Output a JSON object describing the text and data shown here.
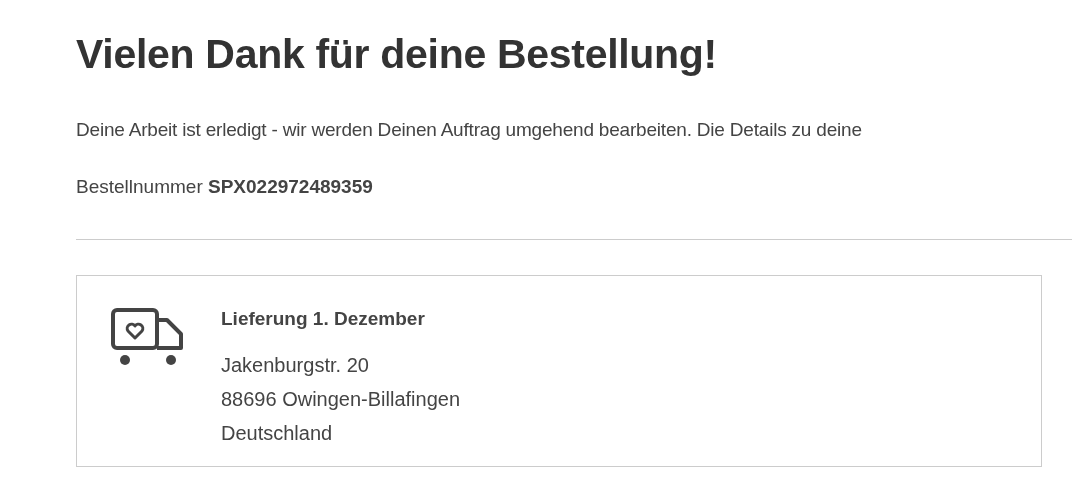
{
  "heading": "Vielen Dank für deine Bestellung!",
  "message": "Deine Arbeit ist erledigt - wir werden Deinen Auftrag umgehend bearbeiten. Die Details zu deine",
  "order": {
    "label": "Bestellnummer",
    "number": "SPX022972489359"
  },
  "delivery": {
    "title": "Lieferung 1. Dezember",
    "address": [
      "Jakenburgstr. 20",
      "88696 Owingen-Billafingen",
      "Deutschland"
    ]
  }
}
